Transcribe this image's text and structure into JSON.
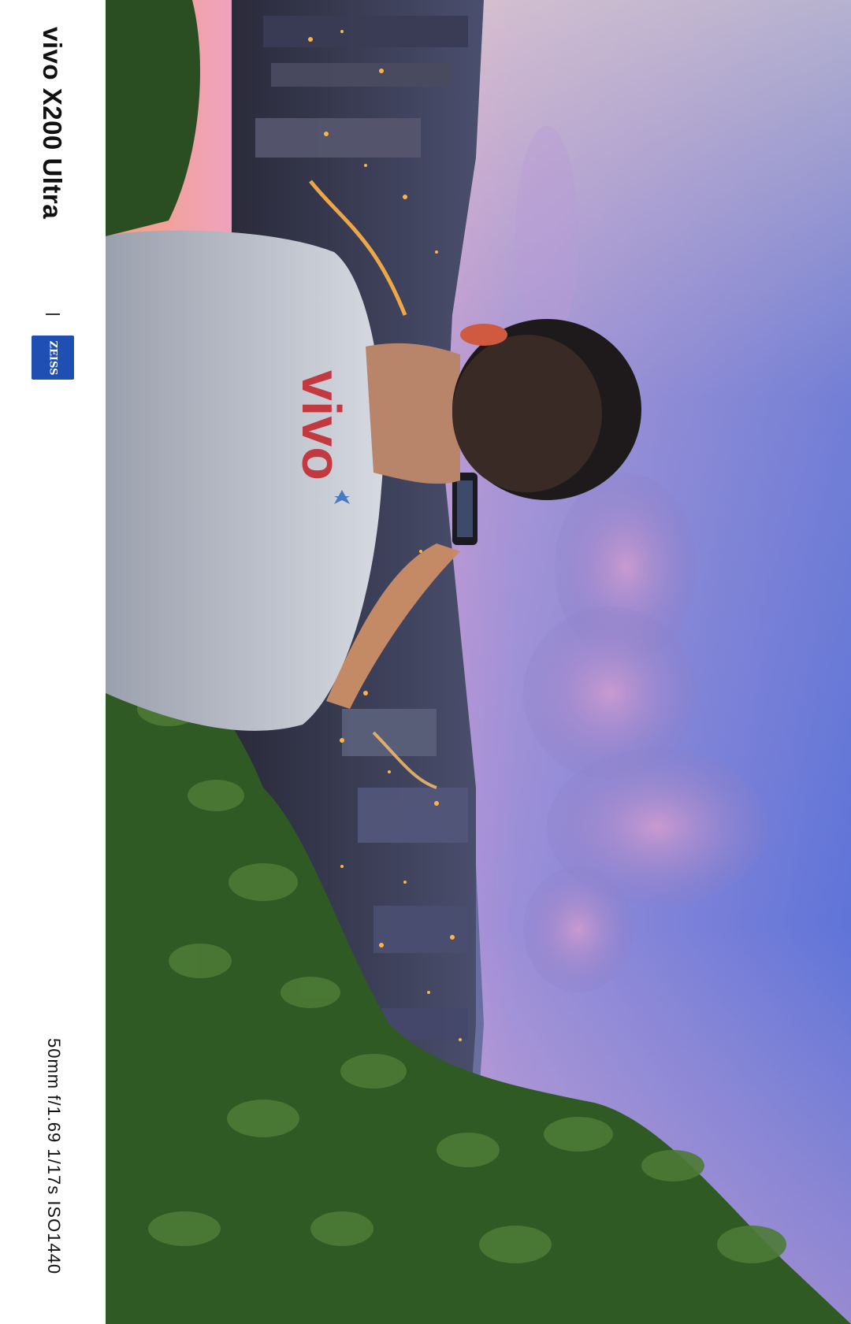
{
  "watermark": {
    "model": "vivo X200 Ultra",
    "brand_logo": "ZEISS",
    "exif": "50mm f/1.69 1/17s ISO1440"
  },
  "photo": {
    "shirt_print": "vivo",
    "colors": {
      "sky_top": "#6b6fd6",
      "sky_glow": "#f0a3b8",
      "clouds": "#9a86c8",
      "city_lights": "#ffb347",
      "foliage": "#2f5a24",
      "shirt": "#c9ced8",
      "zeiss_blue": "#1f4fb3"
    }
  }
}
